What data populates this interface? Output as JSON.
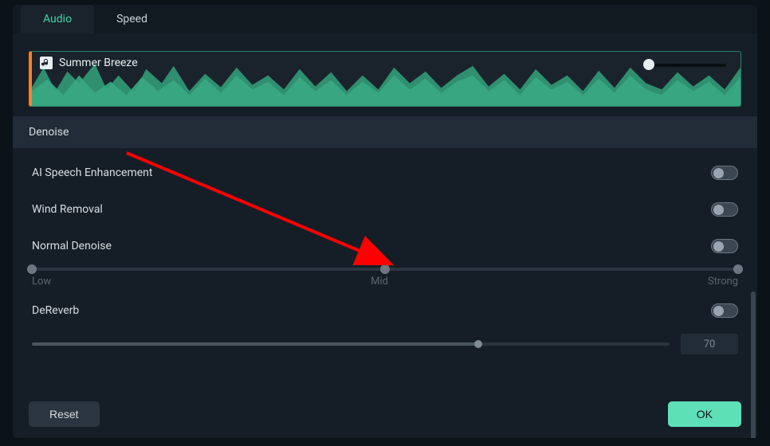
{
  "tabs": {
    "audio": "Audio",
    "speed": "Speed"
  },
  "track": {
    "title": "Summer Breeze"
  },
  "section": {
    "denoise_header": "Denoise"
  },
  "options": {
    "ai_speech": "AI Speech Enhancement",
    "wind_removal": "Wind Removal",
    "normal_denoise": "Normal Denoise",
    "dereverb": "DeReverb"
  },
  "slider_labels": {
    "low": "Low",
    "mid": "Mid",
    "strong": "Strong"
  },
  "dereverb_value": "70",
  "buttons": {
    "reset": "Reset",
    "ok": "OK"
  },
  "colors": {
    "accent": "#3fd6a6",
    "ok_button": "#5ee0b7",
    "arrow": "#ff0000"
  }
}
